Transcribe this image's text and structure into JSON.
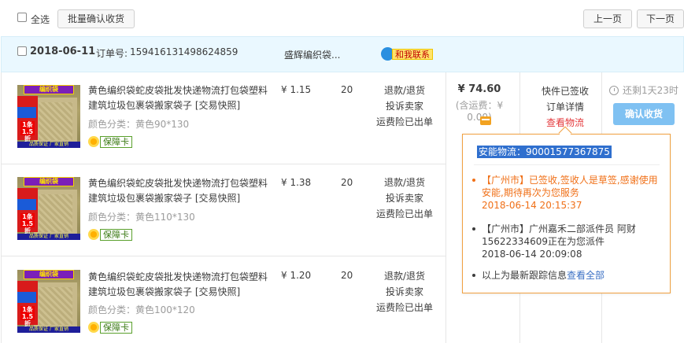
{
  "toolbar": {
    "select_all_label": "全选",
    "batch_confirm_label": "批量确认收货",
    "prev_page_label": "上一页",
    "next_page_label": "下一页"
  },
  "order": {
    "date": "2018-06-11",
    "order_no_label": "订单号:",
    "order_no": "159416131498624859",
    "shop_name": "盛辉编织袋...",
    "contact_label": "和我联系",
    "total_amount": "¥ 74.60",
    "shipping_note": "(含运费：¥ 0.00)",
    "status_lines": [
      "快件已签收",
      "订单详情",
      "查看物流"
    ],
    "remaining": "还剩1天23时",
    "confirm_label": "确认收货"
  },
  "items": [
    {
      "title": "黄色编织袋蛇皮袋批发快递物流打包袋塑料建筑垃圾包裹袋搬家袋子 [交易快照]",
      "spec": "颜色分类：黄色90*130",
      "price": "¥ 1.15",
      "qty": "20",
      "ops": [
        "退款/退货",
        "投诉卖家",
        "运费险已出单"
      ],
      "guarantee": "保障卡"
    },
    {
      "title": "黄色编织袋蛇皮袋批发快递物流打包袋塑料建筑垃圾包裹袋搬家袋子 [交易快照]",
      "spec": "颜色分类：黄色110*130",
      "price": "¥ 1.38",
      "qty": "20",
      "ops": [
        "退款/退货",
        "投诉卖家",
        "运费险已出单"
      ],
      "guarantee": "保障卡"
    },
    {
      "title": "黄色编织袋蛇皮袋批发快递物流打包袋塑料建筑垃圾包裹袋搬家袋子 [交易快照]",
      "spec": "颜色分类：黄色100*120",
      "price": "¥ 1.20",
      "qty": "20",
      "ops": [
        "退款/退货",
        "投诉卖家",
        "运费险已出单"
      ],
      "guarantee": "保障卡"
    }
  ],
  "thumb": {
    "banner": "编织袋",
    "tag": "1条 1.5折",
    "foot": "品质保证 厂家直销"
  },
  "logistics": {
    "tracking": "安能物流：90001577367875",
    "events": [
      {
        "text": "【广州市】已签收,签收人是草签,感谢使用安能,期待再次为您服务",
        "time": "2018-06-14 20:15:37"
      },
      {
        "text": "【广州市】广州嘉禾二部派件员 阿财 15622334609正在为您派件",
        "time": "2018-06-14 20:09:08"
      }
    ],
    "footer_text": "以上为最新跟踪信息",
    "view_all": "查看全部"
  },
  "colors": {
    "header_bg": "#eaf8ff",
    "accent_red": "#e4393c",
    "confirm_bg": "#7fc1f2",
    "popover_border": "#f0a040",
    "event_orange": "#f07018"
  }
}
